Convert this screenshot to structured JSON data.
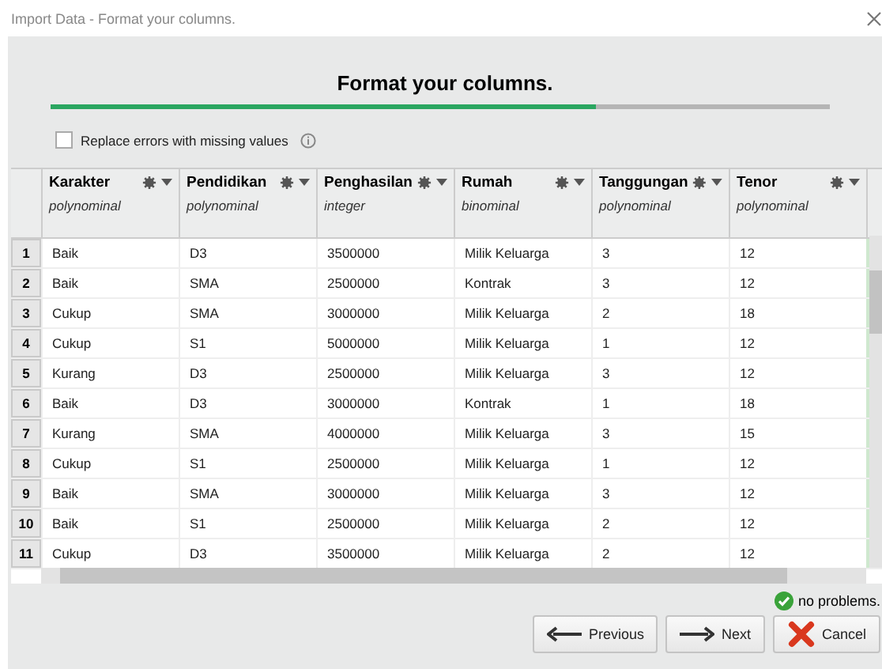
{
  "window": {
    "title": "Import Data - Format your columns."
  },
  "heading": "Format your columns.",
  "progress": {
    "level": 0.7
  },
  "replace_errors": {
    "label": "Replace errors with missing values",
    "checked": false
  },
  "table": {
    "columns": [
      {
        "name": "Karakter",
        "type": "polynominal"
      },
      {
        "name": "Pendidikan",
        "type": "polynominal"
      },
      {
        "name": "Penghasilan",
        "type": "integer"
      },
      {
        "name": "Rumah",
        "type": "binominal"
      },
      {
        "name": "Tanggungan",
        "type": "polynominal"
      },
      {
        "name": "Tenor",
        "type": "polynominal"
      }
    ],
    "rows": [
      {
        "n": "1",
        "cells": [
          "Baik",
          "D3",
          "3500000",
          "Milik Keluarga",
          "3",
          "12"
        ]
      },
      {
        "n": "2",
        "cells": [
          "Baik",
          "SMA",
          "2500000",
          "Kontrak",
          "3",
          "12"
        ]
      },
      {
        "n": "3",
        "cells": [
          "Cukup",
          "SMA",
          "3000000",
          "Milik Keluarga",
          "2",
          "18"
        ]
      },
      {
        "n": "4",
        "cells": [
          "Cukup",
          "S1",
          "5000000",
          "Milik Keluarga",
          "1",
          "12"
        ]
      },
      {
        "n": "5",
        "cells": [
          "Kurang",
          "D3",
          "2500000",
          "Milik Keluarga",
          "3",
          "12"
        ]
      },
      {
        "n": "6",
        "cells": [
          "Baik",
          "D3",
          "3000000",
          "Kontrak",
          "1",
          "18"
        ]
      },
      {
        "n": "7",
        "cells": [
          "Kurang",
          "SMA",
          "4000000",
          "Milik Keluarga",
          "3",
          "15"
        ]
      },
      {
        "n": "8",
        "cells": [
          "Cukup",
          "S1",
          "2500000",
          "Milik Keluarga",
          "1",
          "12"
        ]
      },
      {
        "n": "9",
        "cells": [
          "Baik",
          "SMA",
          "3000000",
          "Milik Keluarga",
          "3",
          "12"
        ]
      },
      {
        "n": "10",
        "cells": [
          "Baik",
          "S1",
          "2500000",
          "Milik Keluarga",
          "2",
          "12"
        ]
      },
      {
        "n": "11",
        "cells": [
          "Cukup",
          "D3",
          "3500000",
          "Milik Keluarga",
          "2",
          "12"
        ]
      }
    ]
  },
  "status": "no problems.",
  "buttons": [
    {
      "kind": "previous",
      "label": "Previous"
    },
    {
      "kind": "next",
      "label": "Next"
    },
    {
      "kind": "cancel",
      "label": "Cancel"
    }
  ]
}
